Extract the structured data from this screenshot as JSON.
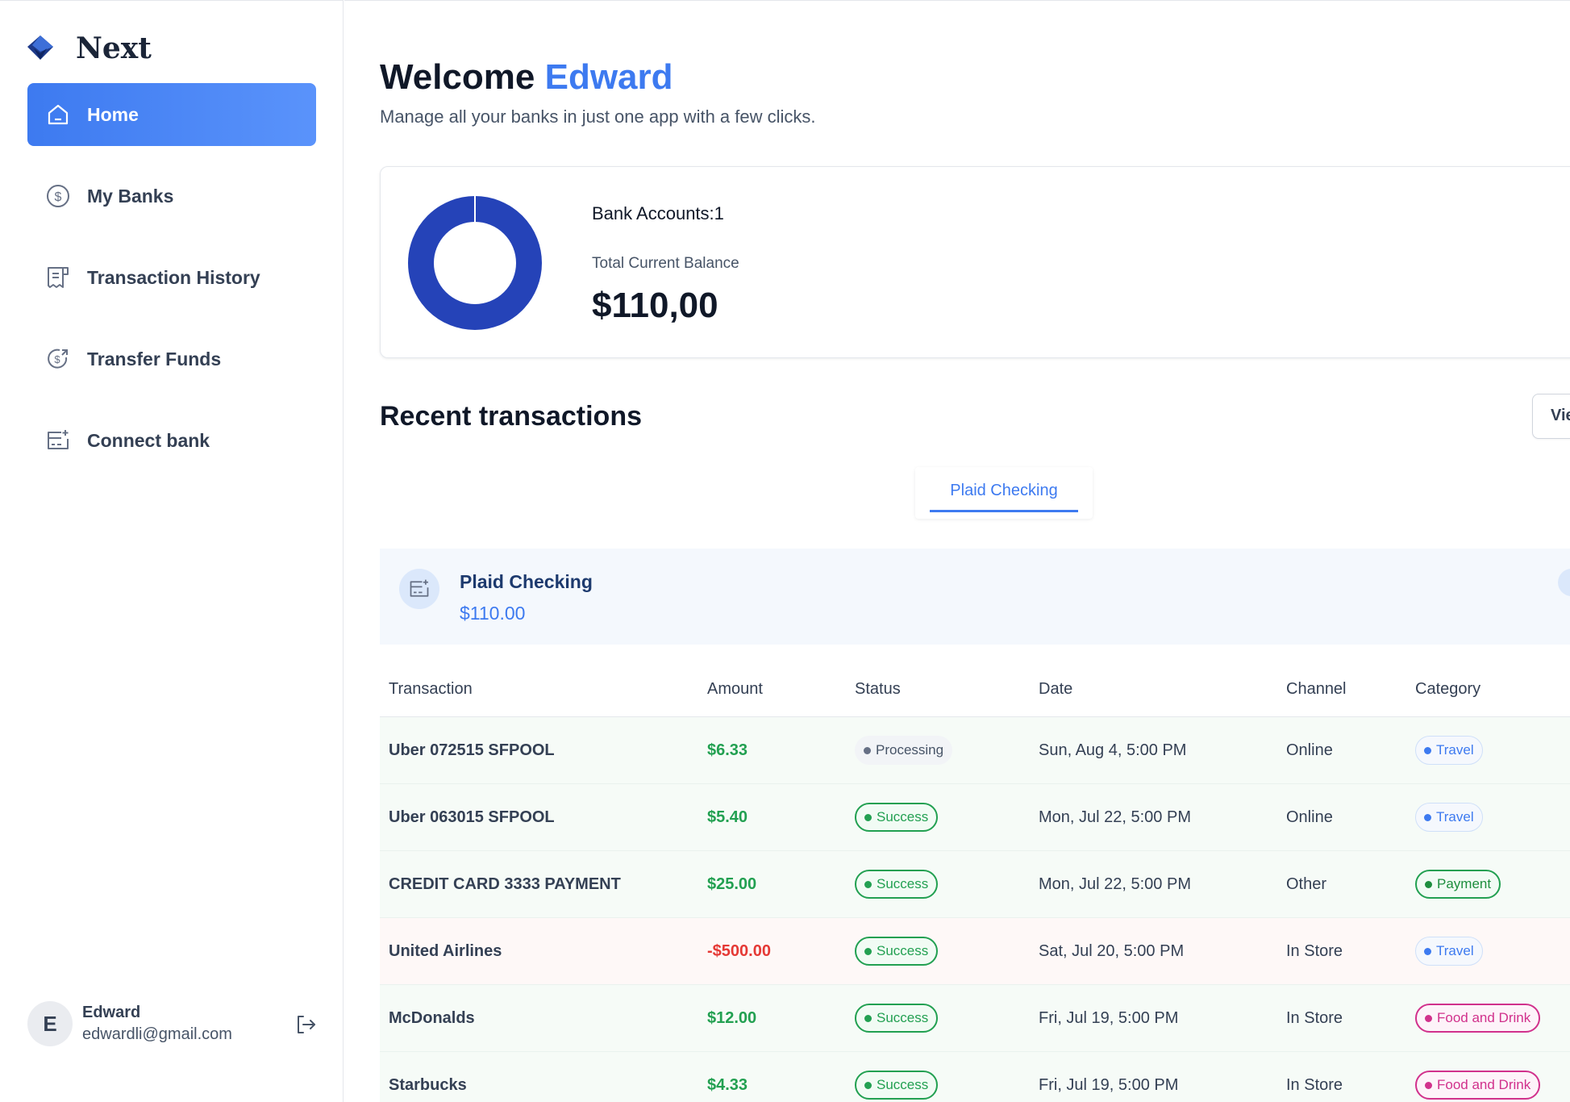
{
  "brand": {
    "name": "Next",
    "accent": "#3d7af0"
  },
  "nav": {
    "items": [
      {
        "label": "Home",
        "icon": "home-icon",
        "active": true
      },
      {
        "label": "My Banks",
        "icon": "dollar-circle-icon",
        "active": false
      },
      {
        "label": "Transaction History",
        "icon": "receipt-icon",
        "active": false
      },
      {
        "label": "Transfer Funds",
        "icon": "money-send-icon",
        "active": false
      },
      {
        "label": "Connect bank",
        "icon": "card-add-icon",
        "active": false
      }
    ]
  },
  "user": {
    "initial": "E",
    "name": "Edward",
    "email": "edwardli@gmail.com"
  },
  "header": {
    "welcome": "Welcome",
    "name": "Edward",
    "subtitle": "Manage all your banks in just one app with a few clicks."
  },
  "balance": {
    "bank_accounts": "Bank Accounts:1",
    "total_label": "Total Current Balance",
    "total_value": "$110,00"
  },
  "recent": {
    "title": "Recent transactions",
    "view_all": "View all",
    "tab": "Plaid Checking"
  },
  "account": {
    "name": "Plaid Checking",
    "balance": "$110.00",
    "type": "checking"
  },
  "table": {
    "headers": [
      "Transaction",
      "Amount",
      "Status",
      "Date",
      "Channel",
      "Category"
    ],
    "rows": [
      {
        "name": "Uber 072515 SFPOOL",
        "amount": "$6.33",
        "status": "Processing",
        "date": "Sun, Aug 4, 5:00 PM",
        "channel": "Online",
        "category": "Travel"
      },
      {
        "name": "Uber 063015 SFPOOL",
        "amount": "$5.40",
        "status": "Success",
        "date": "Mon, Jul 22, 5:00 PM",
        "channel": "Online",
        "category": "Travel"
      },
      {
        "name": "CREDIT CARD 3333 PAYMENT",
        "amount": "$25.00",
        "status": "Success",
        "date": "Mon, Jul 22, 5:00 PM",
        "channel": "Other",
        "category": "Payment"
      },
      {
        "name": "United Airlines",
        "amount": "-$500.00",
        "status": "Success",
        "date": "Sat, Jul 20, 5:00 PM",
        "channel": "In Store",
        "category": "Travel"
      },
      {
        "name": "McDonalds",
        "amount": "$12.00",
        "status": "Success",
        "date": "Fri, Jul 19, 5:00 PM",
        "channel": "In Store",
        "category": "Food and Drink"
      },
      {
        "name": "Starbucks",
        "amount": "$4.33",
        "status": "Success",
        "date": "Fri, Jul 19, 5:00 PM",
        "channel": "In Store",
        "category": "Food and Drink"
      }
    ]
  }
}
